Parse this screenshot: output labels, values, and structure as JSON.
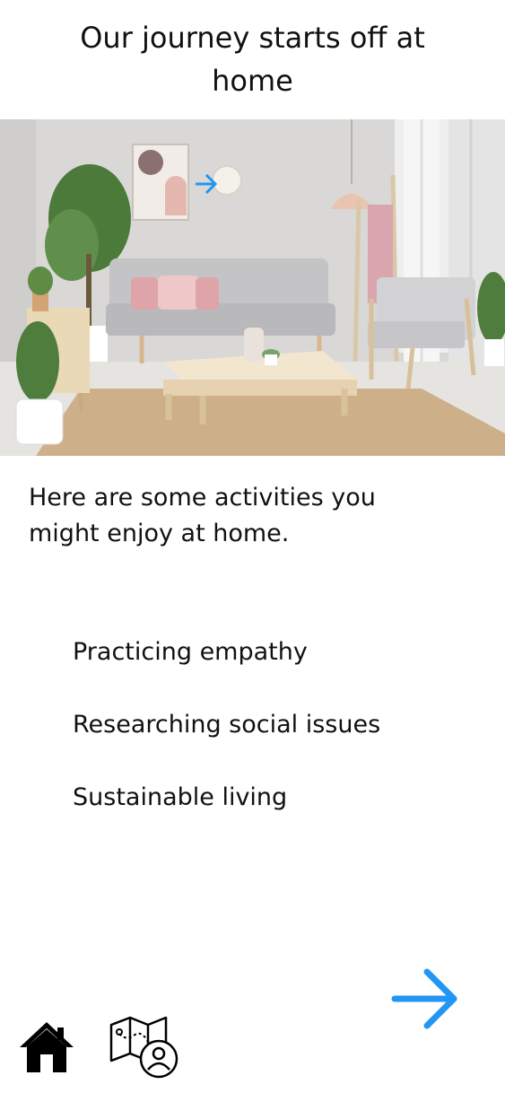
{
  "header": {
    "title": "Our journey starts off at home"
  },
  "hero": {
    "image": "living-room-photo",
    "overlay_icon": "arrow-right-icon"
  },
  "content": {
    "intro": "Here are some activities you might enjoy at home.",
    "activities": [
      "Practicing empathy",
      "Researching social issues",
      "Sustainable living"
    ]
  },
  "navigation": {
    "next_icon": "arrow-right-icon",
    "home_icon": "home-icon",
    "map_icon": "map-location-icon"
  },
  "colors": {
    "accent": "#2196F3",
    "text": "#111111",
    "background": "#FFFFFF"
  }
}
